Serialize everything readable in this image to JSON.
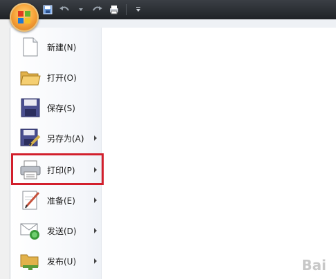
{
  "menu": {
    "items": [
      {
        "label": "新建(N)",
        "icon": "new-document-icon",
        "has_submenu": false
      },
      {
        "label": "打开(O)",
        "icon": "open-folder-icon",
        "has_submenu": false
      },
      {
        "label": "保存(S)",
        "icon": "save-icon",
        "has_submenu": false
      },
      {
        "label": "另存为(A)",
        "icon": "save-as-icon",
        "has_submenu": true
      },
      {
        "label": "打印(P)",
        "icon": "print-icon",
        "has_submenu": true
      },
      {
        "label": "准备(E)",
        "icon": "prepare-icon",
        "has_submenu": true
      },
      {
        "label": "发送(D)",
        "icon": "send-icon",
        "has_submenu": true
      },
      {
        "label": "发布(U)",
        "icon": "publish-icon",
        "has_submenu": true
      }
    ]
  },
  "highlight": {
    "item": "打印(P)",
    "color": "#d21f2c"
  },
  "watermark": "Bai"
}
